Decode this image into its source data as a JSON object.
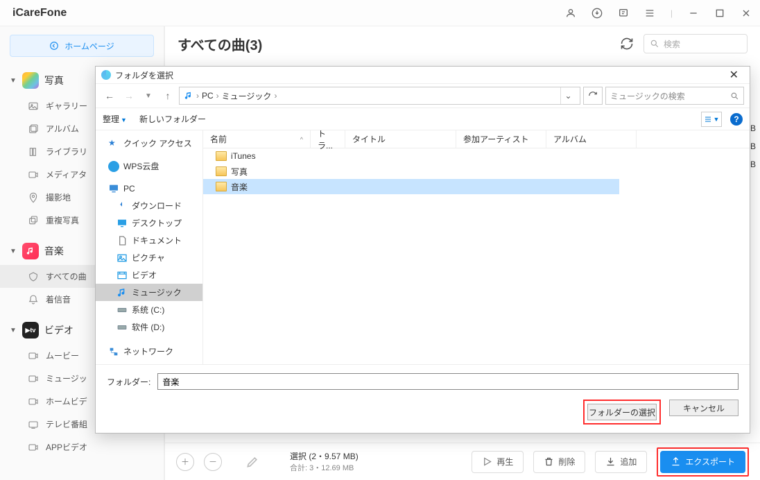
{
  "app": {
    "title": "iCareFone"
  },
  "homepage": {
    "label": "ホームページ"
  },
  "sidebar": {
    "photo": {
      "header": "写真",
      "items": [
        "ギャラリー",
        "アルバム",
        "ライブラリ",
        "メディアタ",
        "撮影地",
        "重複写真"
      ]
    },
    "music": {
      "header": "音楽",
      "items": [
        "すべての曲",
        "着信音"
      ]
    },
    "video": {
      "header": "ビデオ",
      "items": [
        "ムービー",
        "ミュージッ",
        "ホームビデ",
        "テレビ番組",
        "APPビデオ"
      ]
    }
  },
  "main": {
    "title": "すべての曲(3)",
    "search_placeholder": "検索",
    "truncated_col_char": "B"
  },
  "footer": {
    "selection_line": "選択 (2・9.57 MB)",
    "total_line": "合計: 3・12.69 MB",
    "play": "再生",
    "delete": "削除",
    "add": "追加",
    "export": "エクスポート"
  },
  "dialog": {
    "title": "フォルダを選択",
    "breadcrumb": [
      "PC",
      "ミュージック"
    ],
    "search_placeholder": "ミュージックの検索",
    "toolbar": {
      "organize": "整理",
      "newfolder": "新しいフォルダー"
    },
    "columns": {
      "name": "名前",
      "track": "トラ...",
      "title": "タイトル",
      "artist": "参加アーティスト",
      "album": "アルバム"
    },
    "tree": {
      "quick": "クイック アクセス",
      "wps": "WPS云盘",
      "pc": "PC",
      "download": "ダウンロード",
      "desktop": "デスクトップ",
      "documents": "ドキュメント",
      "pictures": "ピクチャ",
      "videos": "ビデオ",
      "music": "ミュージック",
      "sysc": "系统 (C:)",
      "sysd": "软件 (D:)",
      "network": "ネットワーク"
    },
    "files": [
      "iTunes",
      "写真",
      "音楽"
    ],
    "folder_label": "フォルダー:",
    "folder_value": "音楽",
    "select_btn": "フォルダーの選択",
    "cancel_btn": "キャンセル"
  }
}
